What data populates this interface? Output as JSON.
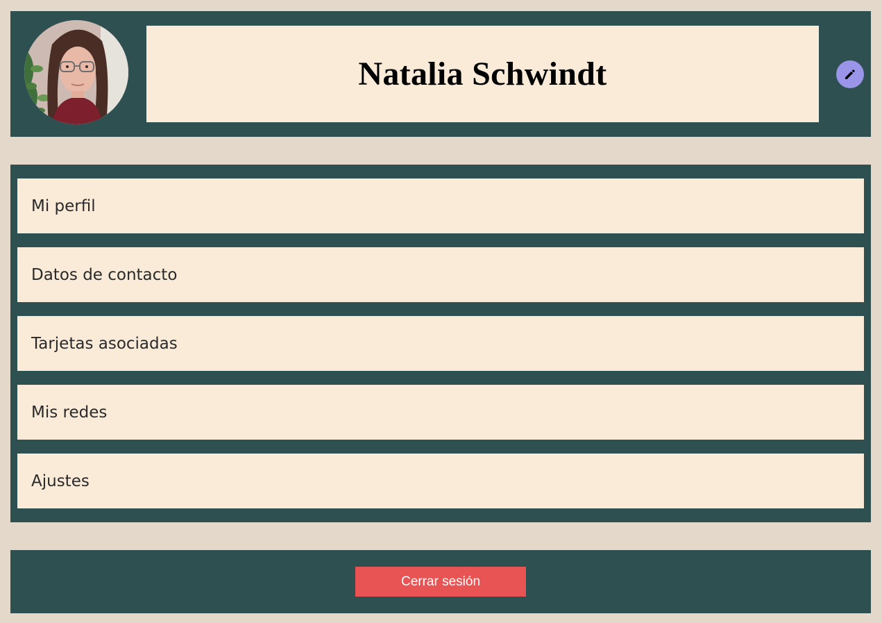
{
  "profile": {
    "name": "Natalia Schwindt",
    "avatar_icon": "user-photo",
    "edit_icon": "pencil-icon"
  },
  "menu": {
    "items": [
      {
        "label": "Mi perfil"
      },
      {
        "label": "Datos de contacto"
      },
      {
        "label": "Tarjetas asociadas"
      },
      {
        "label": "Mis redes"
      },
      {
        "label": "Ajustes"
      }
    ]
  },
  "footer": {
    "logout_label": "Cerrar sesión"
  },
  "colors": {
    "page_background": "#e4d8ca",
    "panel": "#2f5050",
    "card": "#f9ebd8",
    "edit_button": "#9a95e8",
    "logout_button": "#e85454"
  }
}
